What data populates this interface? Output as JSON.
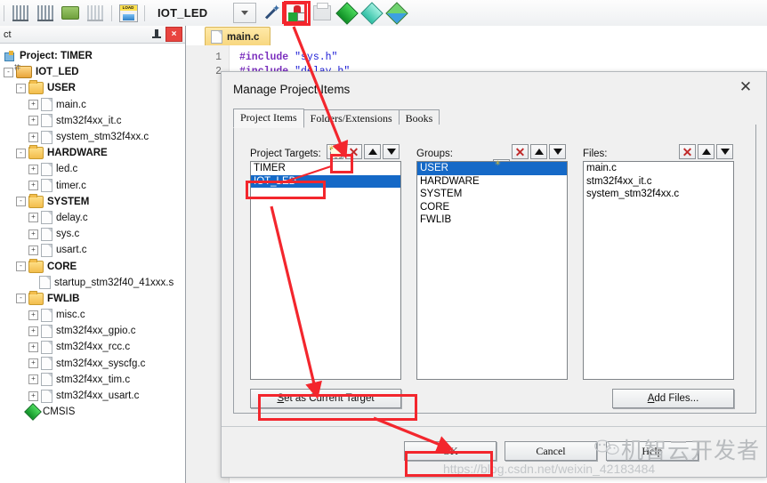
{
  "toolbar": {
    "icons": [
      "build-target-icon",
      "rebuild-all-icon",
      "batch-build-icon",
      "stop-build-icon",
      "load-icon"
    ],
    "project_name": "IOT_LED",
    "right_icons": [
      "combo-dropdown-icon",
      "magic-wand-icon",
      "manage-project-items-icon",
      "print-icon",
      "green-diamond-icon",
      "teal-diamond-icon",
      "multi-diamond-icon"
    ]
  },
  "panel": {
    "title": "ct",
    "pin_icon": "pin-icon",
    "close_icon": "close-icon",
    "root": "Project: TIMER",
    "tree": [
      {
        "label": "IOT_LED",
        "depth": 1,
        "type": "target",
        "expander": "-"
      },
      {
        "label": "USER",
        "depth": 2,
        "type": "folder",
        "expander": "-"
      },
      {
        "label": "main.c",
        "depth": 3,
        "type": "file",
        "expander": "+"
      },
      {
        "label": "stm32f4xx_it.c",
        "depth": 3,
        "type": "file",
        "expander": "+"
      },
      {
        "label": "system_stm32f4xx.c",
        "depth": 3,
        "type": "file",
        "expander": "+"
      },
      {
        "label": "HARDWARE",
        "depth": 2,
        "type": "folder",
        "expander": "-"
      },
      {
        "label": "led.c",
        "depth": 3,
        "type": "file",
        "expander": "+"
      },
      {
        "label": "timer.c",
        "depth": 3,
        "type": "file",
        "expander": "+"
      },
      {
        "label": "SYSTEM",
        "depth": 2,
        "type": "folder",
        "expander": "-"
      },
      {
        "label": "delay.c",
        "depth": 3,
        "type": "file",
        "expander": "+"
      },
      {
        "label": "sys.c",
        "depth": 3,
        "type": "file",
        "expander": "+"
      },
      {
        "label": "usart.c",
        "depth": 3,
        "type": "file",
        "expander": "+"
      },
      {
        "label": "CORE",
        "depth": 2,
        "type": "folder",
        "expander": "-"
      },
      {
        "label": "startup_stm32f40_41xxx.s",
        "depth": 3,
        "type": "file",
        "expander": ""
      },
      {
        "label": "FWLIB",
        "depth": 2,
        "type": "folder",
        "expander": "-"
      },
      {
        "label": "misc.c",
        "depth": 3,
        "type": "file",
        "expander": "+"
      },
      {
        "label": "stm32f4xx_gpio.c",
        "depth": 3,
        "type": "file",
        "expander": "+"
      },
      {
        "label": "stm32f4xx_rcc.c",
        "depth": 3,
        "type": "file",
        "expander": "+"
      },
      {
        "label": "stm32f4xx_syscfg.c",
        "depth": 3,
        "type": "file",
        "expander": "+"
      },
      {
        "label": "stm32f4xx_tim.c",
        "depth": 3,
        "type": "file",
        "expander": "+"
      },
      {
        "label": "stm32f4xx_usart.c",
        "depth": 3,
        "type": "file",
        "expander": "+"
      },
      {
        "label": "CMSIS",
        "depth": 2,
        "type": "cmsis",
        "expander": ""
      }
    ]
  },
  "editor": {
    "tab_label": "main.c",
    "lines": [
      {
        "num": "1",
        "pre": "#include",
        "str": "\"sys.h\""
      },
      {
        "num": "2",
        "pre": "#include",
        "str": "\"delay.h\""
      }
    ]
  },
  "dialog": {
    "title": "Manage Project Items",
    "close_icon": "close-icon",
    "tabs": [
      {
        "label": "Project Items",
        "active": true
      },
      {
        "label": "Folders/Extensions",
        "active": false
      },
      {
        "label": "Books",
        "active": false
      }
    ],
    "targets": {
      "label": "Project Targets:",
      "tools": [
        "new-item-icon",
        "delete-item-icon",
        "move-up-icon",
        "move-down-icon"
      ],
      "items": [
        {
          "label": "TIMER",
          "selected": false
        },
        {
          "label": "IOT_LED",
          "selected": true
        }
      ]
    },
    "groups": {
      "label": "Groups:",
      "tools": [
        "new-item-icon",
        "delete-item-icon",
        "move-up-icon",
        "move-down-icon"
      ],
      "items": [
        {
          "label": "USER",
          "selected": true
        },
        {
          "label": "HARDWARE",
          "selected": false
        },
        {
          "label": "SYSTEM",
          "selected": false
        },
        {
          "label": "CORE",
          "selected": false
        },
        {
          "label": "FWLIB",
          "selected": false
        }
      ]
    },
    "files": {
      "label": "Files:",
      "tools": [
        "delete-item-icon",
        "move-up-icon",
        "move-down-icon"
      ],
      "items": [
        {
          "label": "main.c",
          "selected": false
        },
        {
          "label": "stm32f4xx_it.c",
          "selected": false
        },
        {
          "label": "system_stm32f4xx.c",
          "selected": false
        }
      ]
    },
    "set_target_button": "Set as Current Target",
    "add_files_button": "Add Files...",
    "ok_button": "OK",
    "cancel_button": "Cancel",
    "help_button": "Help"
  },
  "watermark": {
    "text": "机智云开发者",
    "url": "https://blog.csdn.net/weixin_42183484"
  },
  "colors": {
    "annotation_red": "#f3262d",
    "selection_blue": "#1569c7",
    "tab_yellow": "#f7d67e"
  }
}
